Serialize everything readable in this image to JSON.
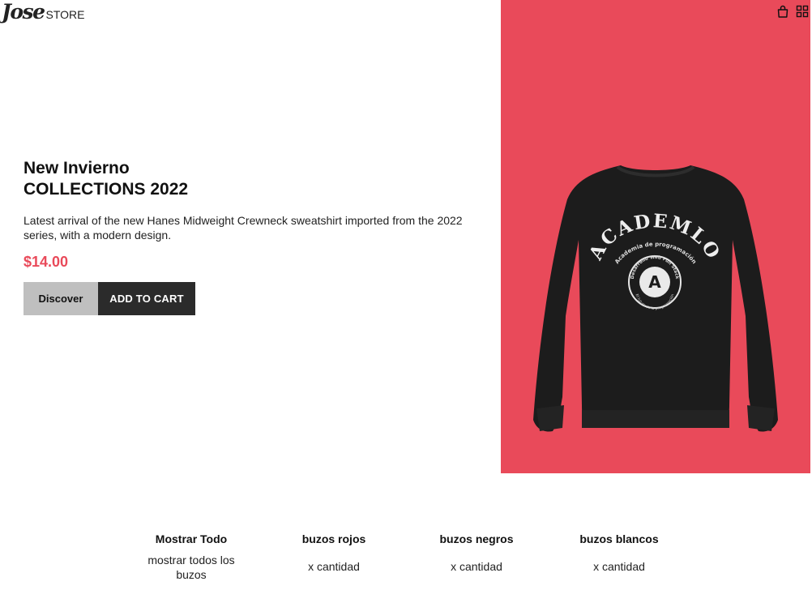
{
  "logo": {
    "mark": "Jose",
    "text": "STORE"
  },
  "header": {
    "icons": [
      "shopping-bag-icon",
      "grid-icon"
    ]
  },
  "hero": {
    "title_line1": "New Invierno",
    "title_line2": "COLLECTIONS 2022",
    "description": "Latest arrival of the new Hanes Midweight Crewneck sweatshirt imported from the 2022 series, with a modern design.",
    "price": "$14.00",
    "discover_label": "Discover",
    "add_to_cart_label": "ADD TO CART"
  },
  "product": {
    "print_text": "ACADEMLO",
    "print_subtext": "Academia de programación",
    "badge_text": "Desarrollo Web Full Stack",
    "badge_bottom": "El futuro de la programación",
    "badge_letter": "A"
  },
  "filters": [
    {
      "title": "Mostrar Todo",
      "subtitle": "mostrar todos los buzos"
    },
    {
      "title": "buzos rojos",
      "subtitle": "x cantidad"
    },
    {
      "title": "buzos negros",
      "subtitle": "x cantidad"
    },
    {
      "title": "buzos blancos",
      "subtitle": "x cantidad"
    }
  ],
  "colors": {
    "accent": "#e94a5a",
    "button_dark": "#2b2b2b",
    "button_light": "#bfbfbf",
    "sweatshirt": "#1c1c1c"
  }
}
